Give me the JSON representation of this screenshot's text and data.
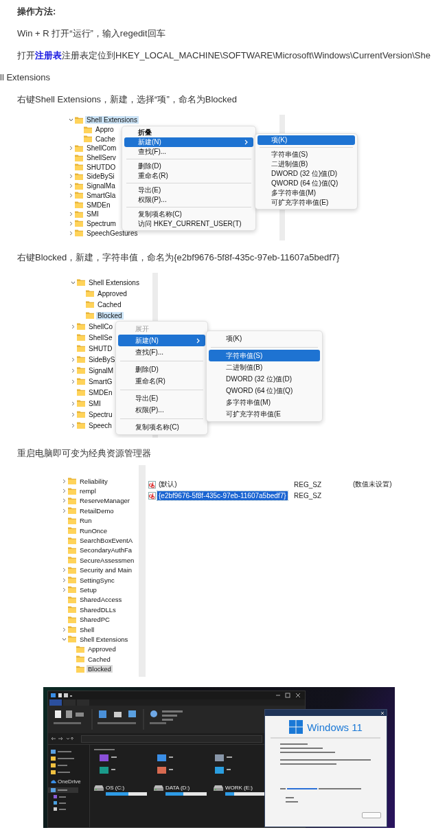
{
  "heading": "操作方法:",
  "blocks": [
    {
      "kind": "paragraph",
      "text": "Win + R 打开“运行”，输入regedit回车"
    },
    {
      "kind": "paragraph",
      "text": "打开",
      "link": "注册表",
      "after": "注册表定位到HKEY_LOCAL_MACHINE\\SOFTWARE\\Microsoft\\Windows\\CurrentVersion\\Shell Extensions"
    },
    {
      "kind": "paragraph",
      "text": "右键Shell Extensions，新建，选择“项”，命名为Blocked"
    },
    {
      "kind": "regedit_menu",
      "tree": [
        {
          "label": "Shell Extensions",
          "kind": "branch",
          "expanded": true,
          "selected": true,
          "children": [
            {
              "label": "Appro",
              "kind": "leaf",
              "selected": false
            },
            {
              "label": "Cache",
              "kind": "leaf",
              "selected": false
            }
          ]
        },
        {
          "label": "ShellCom",
          "kind": "branch",
          "expanded": false,
          "selected": false
        },
        {
          "label": "ShellServ",
          "kind": "leaf",
          "selected": false
        },
        {
          "label": "SHUTDO",
          "kind": "leaf",
          "selected": false
        },
        {
          "label": "SideBySi",
          "kind": "branch",
          "expanded": false,
          "selected": false
        },
        {
          "label": "SignalMa",
          "kind": "branch",
          "expanded": false,
          "selected": false
        },
        {
          "label": "SmartGla",
          "kind": "branch",
          "expanded": false,
          "selected": false
        },
        {
          "label": "SMDEn",
          "kind": "leaf",
          "selected": false
        },
        {
          "label": "SMI",
          "kind": "branch",
          "expanded": false,
          "selected": false
        },
        {
          "label": "Spectrum",
          "kind": "branch",
          "expanded": false,
          "selected": false
        },
        {
          "label": "SpeechGestures",
          "kind": "branch",
          "expanded": false,
          "selected": false
        }
      ],
      "menu": [
        {
          "kind": "item",
          "label": "折叠",
          "selected": false,
          "submenu": false,
          "default": true,
          "disabled": false
        },
        {
          "kind": "item",
          "label": "新建(N)",
          "selected": true,
          "submenu": true,
          "default": false,
          "disabled": false
        },
        {
          "kind": "item",
          "label": "查找(F)...",
          "selected": false,
          "submenu": false,
          "default": false,
          "disabled": false
        },
        {
          "kind": "separator"
        },
        {
          "kind": "item",
          "label": "删除(D)",
          "selected": false,
          "submenu": false,
          "default": false,
          "disabled": false
        },
        {
          "kind": "item",
          "label": "重命名(R)",
          "selected": false,
          "submenu": false,
          "default": false,
          "disabled": false
        },
        {
          "kind": "separator"
        },
        {
          "kind": "item",
          "label": "导出(E)",
          "selected": false,
          "submenu": false,
          "default": false,
          "disabled": false
        },
        {
          "kind": "item",
          "label": "权限(P)...",
          "selected": false,
          "submenu": false,
          "default": false,
          "disabled": false
        },
        {
          "kind": "separator"
        },
        {
          "kind": "item",
          "label": "复制项名称(C)",
          "selected": false,
          "submenu": false,
          "default": false,
          "disabled": false
        },
        {
          "kind": "item",
          "label": "访问 HKEY_CURRENT_USER(T)",
          "selected": false,
          "submenu": false,
          "default": false,
          "disabled": false
        }
      ],
      "submenu": [
        {
          "kind": "item",
          "label": "项(K)",
          "selected": true,
          "submenu": false,
          "default": false,
          "disabled": false
        },
        {
          "kind": "separator"
        },
        {
          "kind": "item",
          "label": "字符串值(S)",
          "selected": false,
          "submenu": false,
          "default": false,
          "disabled": false
        },
        {
          "kind": "item",
          "label": "二进制值(B)",
          "selected": false,
          "submenu": false,
          "default": false,
          "disabled": false
        },
        {
          "kind": "item",
          "label": "DWORD (32 位)值(D)",
          "selected": false,
          "submenu": false,
          "default": false,
          "disabled": false
        },
        {
          "kind": "item",
          "label": "QWORD (64 位)值(Q)",
          "selected": false,
          "submenu": false,
          "default": false,
          "disabled": false
        },
        {
          "kind": "item",
          "label": "多字符串值(M)",
          "selected": false,
          "submenu": false,
          "default": false,
          "disabled": false
        },
        {
          "kind": "item",
          "label": "可扩充字符串值(E)",
          "selected": false,
          "submenu": false,
          "default": false,
          "disabled": false
        }
      ]
    },
    {
      "kind": "paragraph",
      "text": "右键Blocked，新建，字符串值，命名为{e2bf9676-5f8f-435c-97eb-11607a5bedf7}"
    },
    {
      "kind": "regedit_menu",
      "tree": [
        {
          "label": "Shell Extensions",
          "kind": "branch",
          "expanded": true,
          "selected": false,
          "children": [
            {
              "label": "Approved",
              "kind": "leaf",
              "selected": false
            },
            {
              "label": "Cached",
              "kind": "leaf",
              "selected": false
            },
            {
              "label": "Blocked",
              "kind": "leaf",
              "selected": true
            }
          ]
        },
        {
          "label": "ShellCo",
          "kind": "branch",
          "expanded": false,
          "selected": false
        },
        {
          "label": "ShellSe",
          "kind": "leaf",
          "selected": false
        },
        {
          "label": "SHUTD",
          "kind": "leaf",
          "selected": false
        },
        {
          "label": "SideByS",
          "kind": "branch",
          "expanded": false,
          "selected": false
        },
        {
          "label": "SignalM",
          "kind": "branch",
          "expanded": false,
          "selected": false
        },
        {
          "label": "SmartG",
          "kind": "branch",
          "expanded": false,
          "selected": false
        },
        {
          "label": "SMDEn",
          "kind": "leaf",
          "selected": false
        },
        {
          "label": "SMI",
          "kind": "branch",
          "expanded": false,
          "selected": false
        },
        {
          "label": "Spectru",
          "kind": "branch",
          "expanded": false,
          "selected": false
        },
        {
          "label": "Speech",
          "kind": "branch",
          "expanded": false,
          "selected": false
        }
      ],
      "menu": [
        {
          "kind": "item",
          "label": "展开",
          "selected": false,
          "submenu": false,
          "default": false,
          "disabled": true
        },
        {
          "kind": "item",
          "label": "新建(N)",
          "selected": true,
          "submenu": true,
          "default": false,
          "disabled": false
        },
        {
          "kind": "item",
          "label": "查找(F)...",
          "selected": false,
          "submenu": false,
          "default": false,
          "disabled": false
        },
        {
          "kind": "separator"
        },
        {
          "kind": "item",
          "label": "删除(D)",
          "selected": false,
          "submenu": false,
          "default": false,
          "disabled": false
        },
        {
          "kind": "item",
          "label": "重命名(R)",
          "selected": false,
          "submenu": false,
          "default": false,
          "disabled": false
        },
        {
          "kind": "separator"
        },
        {
          "kind": "item",
          "label": "导出(E)",
          "selected": false,
          "submenu": false,
          "default": false,
          "disabled": false
        },
        {
          "kind": "item",
          "label": "权限(P)...",
          "selected": false,
          "submenu": false,
          "default": false,
          "disabled": false
        },
        {
          "kind": "separator"
        },
        {
          "kind": "item",
          "label": "复制项名称(C)",
          "selected": false,
          "submenu": false,
          "default": false,
          "disabled": false
        }
      ],
      "submenu": [
        {
          "kind": "item",
          "label": "项(K)",
          "selected": false,
          "submenu": false,
          "default": false,
          "disabled": false
        },
        {
          "kind": "separator"
        },
        {
          "kind": "item",
          "label": "字符串值(S)",
          "selected": true,
          "submenu": false,
          "default": false,
          "disabled": false
        },
        {
          "kind": "item",
          "label": "二进制值(B)",
          "selected": false,
          "submenu": false,
          "default": false,
          "disabled": false
        },
        {
          "kind": "item",
          "label": "DWORD (32 位)值(D)",
          "selected": false,
          "submenu": false,
          "default": false,
          "disabled": false
        },
        {
          "kind": "item",
          "label": "QWORD (64 位)值(Q)",
          "selected": false,
          "submenu": false,
          "default": false,
          "disabled": false
        },
        {
          "kind": "item",
          "label": "多字符串值(M)",
          "selected": false,
          "submenu": false,
          "default": false,
          "disabled": false
        },
        {
          "kind": "item",
          "label": "可扩充字符串值(E",
          "selected": false,
          "submenu": false,
          "default": false,
          "disabled": false
        }
      ]
    },
    {
      "kind": "paragraph",
      "text": "重启电脑即可变为经典资源管理器"
    },
    {
      "kind": "regedit_values",
      "tree": [
        {
          "label": "Reliability",
          "kind": "branch",
          "expanded": false,
          "selected": false
        },
        {
          "label": "rempl",
          "kind": "branch",
          "expanded": false,
          "selected": false
        },
        {
          "label": "ReserveManager",
          "kind": "branch",
          "expanded": false,
          "selected": false
        },
        {
          "label": "RetailDemo",
          "kind": "branch",
          "expanded": false,
          "selected": false
        },
        {
          "label": "Run",
          "kind": "leaf",
          "selected": false
        },
        {
          "label": "RunOnce",
          "kind": "leaf",
          "selected": false
        },
        {
          "label": "SearchBoxEventA",
          "kind": "leaf",
          "selected": false
        },
        {
          "label": "SecondaryAuthFa",
          "kind": "leaf",
          "selected": false
        },
        {
          "label": "SecureAssessmen",
          "kind": "leaf",
          "selected": false
        },
        {
          "label": "Security and Main",
          "kind": "branch",
          "expanded": false,
          "selected": false
        },
        {
          "label": "SettingSync",
          "kind": "branch",
          "expanded": false,
          "selected": false
        },
        {
          "label": "Setup",
          "kind": "branch",
          "expanded": false,
          "selected": false
        },
        {
          "label": "SharedAccess",
          "kind": "leaf",
          "selected": false
        },
        {
          "label": "SharedDLLs",
          "kind": "leaf",
          "selected": false
        },
        {
          "label": "SharedPC",
          "kind": "leaf",
          "selected": false
        },
        {
          "label": "Shell",
          "kind": "branch",
          "expanded": false,
          "selected": false
        },
        {
          "label": "Shell Extensions",
          "kind": "branch",
          "expanded": true,
          "selected": false,
          "children": [
            {
              "label": "Approved",
              "kind": "leaf",
              "selected": false
            },
            {
              "label": "Cached",
              "kind": "leaf",
              "selected": false
            },
            {
              "label": "Blocked",
              "kind": "leaf",
              "selected": true
            }
          ]
        }
      ],
      "values": [
        {
          "name": "(默认)",
          "type": "REG_SZ",
          "data": "(数值未设置)",
          "selected": false
        },
        {
          "name": "{e2bf9676-5f8f-435c-97eb-11607a5bedf7}",
          "type": "REG_SZ",
          "selected": true
        }
      ]
    },
    {
      "kind": "explorer",
      "sidebar": [
        {
          "label": "OneDrive"
        }
      ],
      "drives": [
        {
          "label": "OS (C:)",
          "level": 0.55
        },
        {
          "label": "DATA (D:)",
          "level": 0.43
        },
        {
          "label": "WORK (E:)",
          "level": 0.21
        }
      ],
      "about": {
        "product": "Windows 11"
      }
    }
  ]
}
